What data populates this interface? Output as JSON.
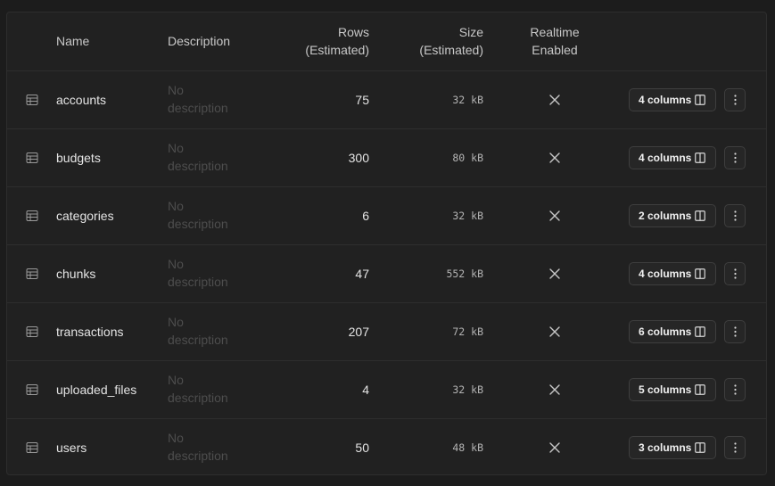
{
  "header": {
    "name": "Name",
    "description": "Description",
    "rows_line1": "Rows",
    "rows_line2": "(Estimated)",
    "size_line1": "Size",
    "size_line2": "(Estimated)",
    "realtime_line1": "Realtime",
    "realtime_line2": "Enabled"
  },
  "tables": [
    {
      "name": "accounts",
      "description_line1": "No",
      "description_line2": "description",
      "rows": "75",
      "size": "32 kB",
      "realtime": "disabled",
      "columns_label": "4 columns"
    },
    {
      "name": "budgets",
      "description_line1": "No",
      "description_line2": "description",
      "rows": "300",
      "size": "80 kB",
      "realtime": "disabled",
      "columns_label": "4 columns"
    },
    {
      "name": "categories",
      "description_line1": "No",
      "description_line2": "description",
      "rows": "6",
      "size": "32 kB",
      "realtime": "disabled",
      "columns_label": "2 columns"
    },
    {
      "name": "chunks",
      "description_line1": "No",
      "description_line2": "description",
      "rows": "47",
      "size": "552 kB",
      "realtime": "disabled",
      "columns_label": "4 columns"
    },
    {
      "name": "transactions",
      "description_line1": "No",
      "description_line2": "description",
      "rows": "207",
      "size": "72 kB",
      "realtime": "disabled",
      "columns_label": "6 columns"
    },
    {
      "name": "uploaded_files",
      "description_line1": "No",
      "description_line2": "description",
      "rows": "4",
      "size": "32 kB",
      "realtime": "disabled",
      "columns_label": "5 columns"
    },
    {
      "name": "users",
      "description_line1": "No",
      "description_line2": "description",
      "rows": "50",
      "size": "48 kB",
      "realtime": "disabled",
      "columns_label": "3 columns"
    }
  ],
  "icons": {
    "table": "table-icon",
    "realtime_off": "x-icon",
    "columns": "columns-icon",
    "more": "more-vertical-icon"
  },
  "colors": {
    "background": "#1c1c1c",
    "panel": "#212121",
    "border": "#2e2e2e",
    "text": "#e4e4e4",
    "muted_text": "#4d4d4d"
  }
}
